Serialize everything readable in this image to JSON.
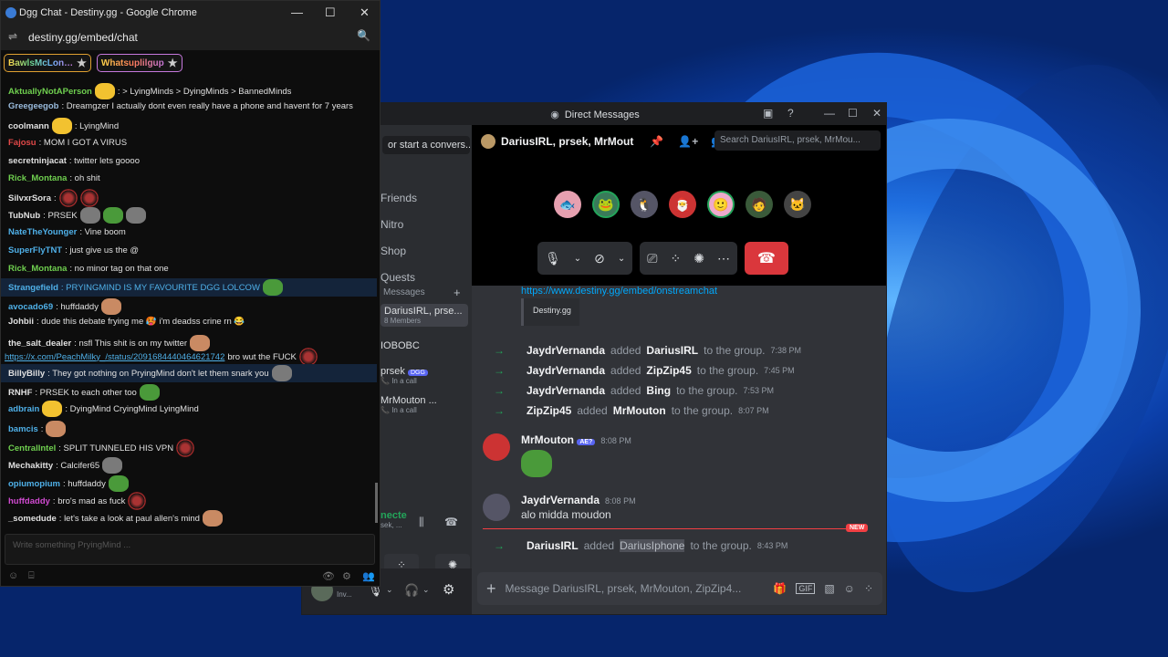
{
  "chrome": {
    "title": "Dgg Chat - Destiny.gg - Google Chrome",
    "url": "destiny.gg/embed/chat",
    "pinned": [
      {
        "label": "BawlsMcLon…",
        "color": "#7ad"
      },
      {
        "label": "Whatsuplilgup",
        "color": "#c678dd"
      }
    ],
    "lines": [
      {
        "user": "AktuallyNotAPerson",
        "color": "#6fcf4f",
        "text": ": > LyingMinds > DyingMinds > BannedMinds"
      },
      {
        "user": "Greegeegob",
        "color": "#9bd",
        "text": ": Dreamgzer I actually dont even really have a phone and havent for 7 years"
      },
      {
        "user": "coolmann",
        "color": "#ddd",
        "text": ": LyingMind"
      },
      {
        "user": "Fajosu",
        "color": "#e04848",
        "text": ": MOM I GOT A VIRUS"
      },
      {
        "user": "secretninjacat",
        "color": "#ddd",
        "text": ": twitter lets goooo"
      },
      {
        "user": "Rick_Montana",
        "color": "#6fcf4f",
        "text": ": oh shit"
      },
      {
        "user": "SilvxrSora",
        "color": "#ddd",
        "text": ":"
      },
      {
        "user": "TubNub",
        "color": "#ddd",
        "text": ": PRSEK"
      },
      {
        "user": "NateTheYounger",
        "color": "#4fb0e8",
        "text": ": Vine boom"
      },
      {
        "user": "SuperFlyTNT",
        "color": "#4fb0e8",
        "text": ": just give us the @"
      },
      {
        "user": "Rick_Montana",
        "color": "#6fcf4f",
        "text": ": no minor tag on that one"
      },
      {
        "user": "Strangefield",
        "color": "#4fb0e8",
        "text": ": PRYINGMIND IS MY FAVOURITE DGG LOLCOW",
        "textcolor": "#4fb0e8"
      },
      {
        "user": "avocado69",
        "color": "#4fb0e8",
        "text": ": huffdaddy"
      },
      {
        "user": "Johbii",
        "color": "#ddd",
        "text": ": dude this debate frying me 🥵 i'm deadss crine rn 😂"
      },
      {
        "user": "the_salt_dealer",
        "color": "#ddd",
        "text": ": nsfl This shit is on my twitter"
      },
      {
        "user": "",
        "color": "#ddd",
        "link": "https://x.com/PeachMilky_/status/2091684440464621742",
        "text": "bro wut the FUCK"
      },
      {
        "user": "BillyBilly",
        "color": "#ddd",
        "text": ": They got nothing on PryingMind don't let them snark you"
      },
      {
        "user": "RNHF",
        "color": "#ddd",
        "text": ": PRSEK to each other too"
      },
      {
        "user": "adbrain",
        "color": "#4fb0e8",
        "text": ": DyingMind CryingMind LyingMind"
      },
      {
        "user": "bamcis",
        "color": "#4fb0e8",
        "text": ":"
      },
      {
        "user": "CentralIntel",
        "color": "#6fcf4f",
        "text": ": SPLIT TUNNELED HIS VPN"
      },
      {
        "user": "Mechakitty",
        "color": "#ddd",
        "text": ": Calcifer65"
      },
      {
        "user": "opiumopium",
        "color": "#4fb0e8",
        "text": ": huffdaddy"
      },
      {
        "user": "huffdaddy",
        "color": "#d04ad0",
        "text": ": bro's mad as fuck"
      },
      {
        "user": "_somedude",
        "color": "#ddd",
        "text": ": let's take a look at paul allen's mind"
      }
    ],
    "input_placeholder": "Write something PryingMind ..."
  },
  "discord": {
    "title": "Direct Messages",
    "search_dm": "or start a convers...",
    "nav": [
      "Friends",
      "Nitro",
      "Shop",
      "Quests"
    ],
    "dm_header": "Messages",
    "dms": [
      {
        "name": "DariusIRL, prse...",
        "sub": "8 Members"
      },
      {
        "name": "IOBOBC",
        "sub": ""
      },
      {
        "name": "prsek",
        "badge": "DGG",
        "sub": "In a call"
      },
      {
        "name": "MrMouton ...",
        "sub": "In a call"
      }
    ],
    "voice_status": "necte",
    "voice_sub": "sek, ...",
    "user_status": "Inv...",
    "channel_name": "DariusIRL, prsek, MrMout",
    "search_placeholder": "Search DariusIRL, prsek, MrMou...",
    "embed_link": "https://www.destiny.gg/embed/onstreamchat",
    "embed_card": "Destiny.gg",
    "system": [
      {
        "a": "JaydrVernanda",
        "verb": "added",
        "b": "DariusIRL",
        "tail": "to the group.",
        "time": "7:38 PM"
      },
      {
        "a": "JaydrVernanda",
        "verb": "added",
        "b": "ZipZip45",
        "tail": "to the group.",
        "time": "7:45 PM"
      },
      {
        "a": "JaydrVernanda",
        "verb": "added",
        "b": "Bing",
        "tail": "to the group.",
        "time": "7:53 PM"
      },
      {
        "a": "ZipZip45",
        "verb": "added",
        "b": "MrMouton",
        "tail": "to the group.",
        "time": "8:07 PM"
      }
    ],
    "msg1": {
      "user": "MrMouton",
      "tag": "AE?",
      "time": "8:08 PM"
    },
    "msg2": {
      "user": "JaydrVernanda",
      "time": "8:08 PM",
      "text": "alo midda moudon"
    },
    "new_badge": "NEW",
    "last_system": {
      "a": "DariusIRL",
      "verb": "added",
      "b": "DariusIphone",
      "tail": "to the group.",
      "time": "8:43 PM"
    },
    "message_placeholder": "Message DariusIRL, prsek, MrMouton, ZipZip4..."
  }
}
